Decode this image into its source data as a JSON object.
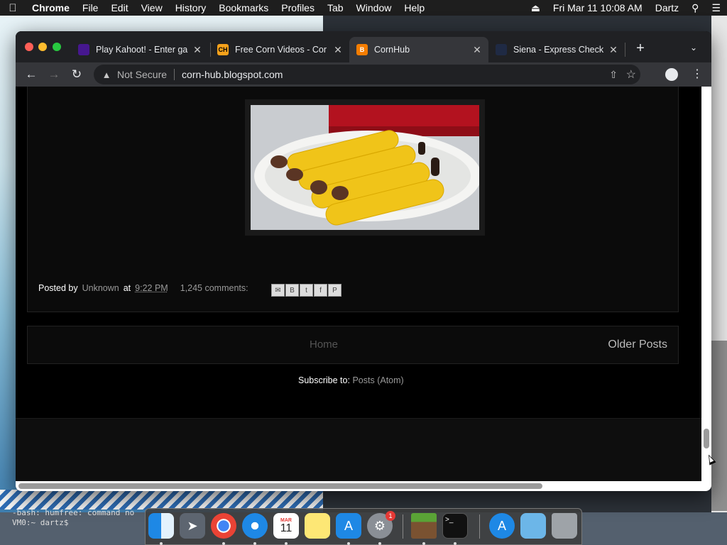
{
  "menubar": {
    "app": "Chrome",
    "items": [
      "File",
      "Edit",
      "View",
      "History",
      "Bookmarks",
      "Profiles",
      "Tab",
      "Window",
      "Help"
    ],
    "datetime": "Fri Mar 11  10:08 AM",
    "user": "Dartz"
  },
  "tabs": [
    {
      "title": "Play Kahoot! - Enter ga",
      "favicon_color": "#46178f",
      "favicon_text": ""
    },
    {
      "title": "Free Corn Videos - Cor",
      "favicon_color": "#f7a21b",
      "favicon_text": "CH"
    },
    {
      "title": "CornHub",
      "favicon_color": "#f57d00",
      "favicon_text": "B"
    },
    {
      "title": "Siena - Express Check",
      "favicon_color": "#1f2a44",
      "favicon_text": ""
    }
  ],
  "omnibox": {
    "security": "Not Secure",
    "url": "corn-hub.blogspot.com"
  },
  "post": {
    "posted_by_label": "Posted by",
    "author": "Unknown",
    "at_label": "at",
    "time": "9:22 PM",
    "comments": "1,245 comments:"
  },
  "pager": {
    "home": "Home",
    "older": "Older Posts"
  },
  "subscribe": {
    "label": "Subscribe to:",
    "link": "Posts (Atom)"
  },
  "terminal": {
    "line1": "-bash: humfree: command no",
    "line2": "VM0:~ dartz$ "
  },
  "dock": {
    "calendar_month": "MAR",
    "calendar_day": "11",
    "settings_badge": "1"
  },
  "colors": {
    "page_bg": "#000000",
    "link_grey": "#999999",
    "tabbar": "#202124"
  }
}
